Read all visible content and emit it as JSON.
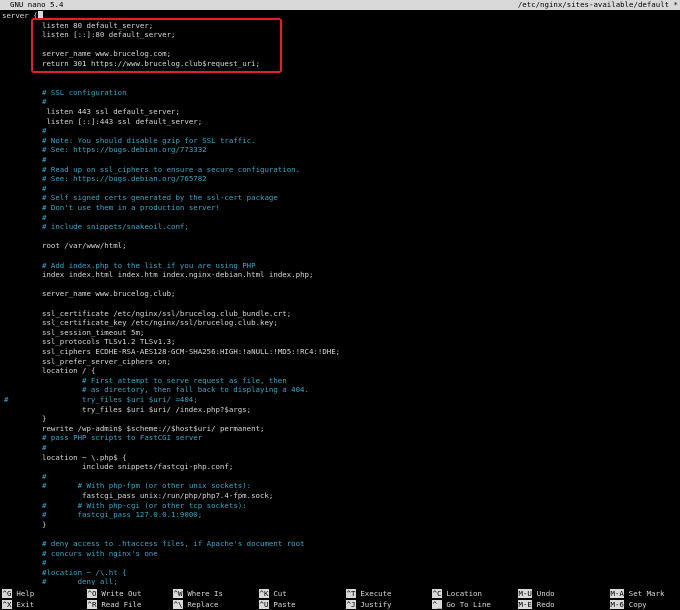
{
  "title_bar": {
    "app": "GNU nano 5.4",
    "file": "/etc/nginx/sites-available/default *"
  },
  "editor_lines": [
    {
      "text": "server {",
      "kind": "code",
      "indent": 0,
      "gutter": ""
    },
    {
      "text": "listen 80 default_server;",
      "kind": "code",
      "indent": 40,
      "gutter": ""
    },
    {
      "text": "listen [::]:80 default_server;",
      "kind": "code",
      "indent": 40,
      "gutter": ""
    },
    {
      "text": "",
      "kind": "code",
      "indent": 40,
      "gutter": ""
    },
    {
      "text": "server_name www.brucelog.com;",
      "kind": "code",
      "indent": 40,
      "gutter": ""
    },
    {
      "text": "return 301 https://www.brucelog.club$request_uri;",
      "kind": "code",
      "indent": 40,
      "gutter": ""
    },
    {
      "text": "",
      "kind": "code",
      "indent": 40,
      "gutter": ""
    },
    {
      "text": "",
      "kind": "code",
      "indent": 40,
      "gutter": ""
    },
    {
      "text": "# SSL configuration",
      "kind": "comment",
      "indent": 40,
      "gutter": ""
    },
    {
      "text": "#",
      "kind": "comment",
      "indent": 40,
      "gutter": ""
    },
    {
      "text": " listen 443 ssl default_server;",
      "kind": "code",
      "indent": 40,
      "gutter": ""
    },
    {
      "text": " listen [::]:443 ssl default_server;",
      "kind": "code",
      "indent": 40,
      "gutter": ""
    },
    {
      "text": "#",
      "kind": "comment",
      "indent": 40,
      "gutter": ""
    },
    {
      "text": "# Note: You should disable gzip for SSL traffic.",
      "kind": "comment",
      "indent": 40,
      "gutter": ""
    },
    {
      "text": "# See: https://bugs.debian.org/773332",
      "kind": "comment",
      "indent": 40,
      "gutter": ""
    },
    {
      "text": "#",
      "kind": "comment",
      "indent": 40,
      "gutter": ""
    },
    {
      "text": "# Read up on ssl_ciphers to ensure a secure configuration.",
      "kind": "comment",
      "indent": 40,
      "gutter": ""
    },
    {
      "text": "# See: https://bugs.debian.org/765782",
      "kind": "comment",
      "indent": 40,
      "gutter": ""
    },
    {
      "text": "#",
      "kind": "comment",
      "indent": 40,
      "gutter": ""
    },
    {
      "text": "# Self signed certs generated by the ssl-cert package",
      "kind": "comment",
      "indent": 40,
      "gutter": ""
    },
    {
      "text": "# Don't use them in a production server!",
      "kind": "comment",
      "indent": 40,
      "gutter": ""
    },
    {
      "text": "#",
      "kind": "comment",
      "indent": 40,
      "gutter": ""
    },
    {
      "text": "# include snippets/snakeoil.conf;",
      "kind": "comment",
      "indent": 40,
      "gutter": ""
    },
    {
      "text": "",
      "kind": "code",
      "indent": 40,
      "gutter": ""
    },
    {
      "text": "root /var/www/html;",
      "kind": "code",
      "indent": 40,
      "gutter": ""
    },
    {
      "text": "",
      "kind": "code",
      "indent": 40,
      "gutter": ""
    },
    {
      "text": "# Add index.php to the list if you are using PHP",
      "kind": "comment",
      "indent": 40,
      "gutter": ""
    },
    {
      "text": "index index.html index.htm index.nginx-debian.html index.php;",
      "kind": "code",
      "indent": 40,
      "gutter": ""
    },
    {
      "text": "",
      "kind": "code",
      "indent": 40,
      "gutter": ""
    },
    {
      "text": "server_name www.brucelog.club;",
      "kind": "code",
      "indent": 40,
      "gutter": ""
    },
    {
      "text": "",
      "kind": "code",
      "indent": 40,
      "gutter": ""
    },
    {
      "text": "ssl_certificate /etc/nginx/ssl/brucelog.club_bundle.crt;",
      "kind": "code",
      "indent": 40,
      "gutter": ""
    },
    {
      "text": "ssl_certificate_key /etc/nginx/ssl/brucelog.club.key;",
      "kind": "code",
      "indent": 40,
      "gutter": ""
    },
    {
      "text": "ssl_session_timeout 5m;",
      "kind": "code",
      "indent": 40,
      "gutter": ""
    },
    {
      "text": "ssl_protocols TLSv1.2 TLSv1.3;",
      "kind": "code",
      "indent": 40,
      "gutter": ""
    },
    {
      "text": "ssl_ciphers ECDHE-RSA-AES128-GCM-SHA256:HIGH:!aNULL:!MD5:!RC4:!DHE;",
      "kind": "code",
      "indent": 40,
      "gutter": ""
    },
    {
      "text": "ssl_prefer_server_ciphers on;",
      "kind": "code",
      "indent": 40,
      "gutter": ""
    },
    {
      "text": "location / {",
      "kind": "code",
      "indent": 40,
      "gutter": ""
    },
    {
      "text": "# First attempt to serve request as file, then",
      "kind": "comment",
      "indent": 80,
      "gutter": ""
    },
    {
      "text": "# as directory, then fall back to displaying a 404.",
      "kind": "comment",
      "indent": 80,
      "gutter": ""
    },
    {
      "text": "try_files $uri $uri/ =404;",
      "kind": "comment",
      "indent": 80,
      "gutter": "#"
    },
    {
      "text": "try_files $uri $uri/ /index.php?$args;",
      "kind": "code",
      "indent": 80,
      "gutter": ""
    },
    {
      "text": "}",
      "kind": "code",
      "indent": 40,
      "gutter": ""
    },
    {
      "text": "rewrite /wp-admin$ $scheme://$host$uri/ permanent;",
      "kind": "code",
      "indent": 40,
      "gutter": ""
    },
    {
      "text": "# pass PHP scripts to FastCGI server",
      "kind": "comment",
      "indent": 40,
      "gutter": ""
    },
    {
      "text": "#",
      "kind": "comment",
      "indent": 40,
      "gutter": ""
    },
    {
      "text": "location ~ \\.php$ {",
      "kind": "code",
      "indent": 40,
      "gutter": ""
    },
    {
      "text": "include snippets/fastcgi-php.conf;",
      "kind": "code",
      "indent": 80,
      "gutter": ""
    },
    {
      "text": "#",
      "kind": "comment",
      "indent": 40,
      "gutter": ""
    },
    {
      "text": "#       # With php-fpm (or other unix sockets):",
      "kind": "comment",
      "indent": 40,
      "gutter": ""
    },
    {
      "text": "fastcgi_pass unix:/run/php/php7.4-fpm.sock;",
      "kind": "code",
      "indent": 80,
      "gutter": ""
    },
    {
      "text": "#       # With php-cgi (or other tcp sockets):",
      "kind": "comment",
      "indent": 40,
      "gutter": ""
    },
    {
      "text": "#       fastcgi_pass 127.0.0.1:9000;",
      "kind": "comment",
      "indent": 40,
      "gutter": ""
    },
    {
      "text": "}",
      "kind": "code",
      "indent": 40,
      "gutter": ""
    },
    {
      "text": "",
      "kind": "code",
      "indent": 40,
      "gutter": ""
    },
    {
      "text": "# deny access to .htaccess files, if Apache's document root",
      "kind": "comment",
      "indent": 40,
      "gutter": ""
    },
    {
      "text": "# concurs with nginx's one",
      "kind": "comment",
      "indent": 40,
      "gutter": ""
    },
    {
      "text": "#",
      "kind": "comment",
      "indent": 40,
      "gutter": ""
    },
    {
      "text": "#location ~ /\\.ht {",
      "kind": "comment",
      "indent": 40,
      "gutter": ""
    },
    {
      "text": "#       deny all;",
      "kind": "comment",
      "indent": 40,
      "gutter": ""
    }
  ],
  "shortcuts_row1": [
    {
      "key": "^G",
      "label": "Help"
    },
    {
      "key": "^O",
      "label": "Write Out"
    },
    {
      "key": "^W",
      "label": "Where Is"
    },
    {
      "key": "^K",
      "label": "Cut"
    },
    {
      "key": "^T",
      "label": "Execute"
    },
    {
      "key": "^C",
      "label": "Location"
    },
    {
      "key": "M-U",
      "label": "Undo"
    },
    {
      "key": "M-A",
      "label": "Set Mark"
    }
  ],
  "shortcuts_row2": [
    {
      "key": "^X",
      "label": "Exit"
    },
    {
      "key": "^R",
      "label": "Read File"
    },
    {
      "key": "^\\",
      "label": "Replace"
    },
    {
      "key": "^U",
      "label": "Paste"
    },
    {
      "key": "^J",
      "label": "Justify"
    },
    {
      "key": "^_",
      "label": "Go To Line"
    },
    {
      "key": "M-E",
      "label": "Redo"
    },
    {
      "key": "M-6",
      "label": "Copy"
    }
  ],
  "colors": {
    "background": "#000000",
    "text": "#d8d8d8",
    "comment": "#3aa6c6",
    "title_bar": "#d9d9d9",
    "highlight_box": "#e0202a"
  }
}
